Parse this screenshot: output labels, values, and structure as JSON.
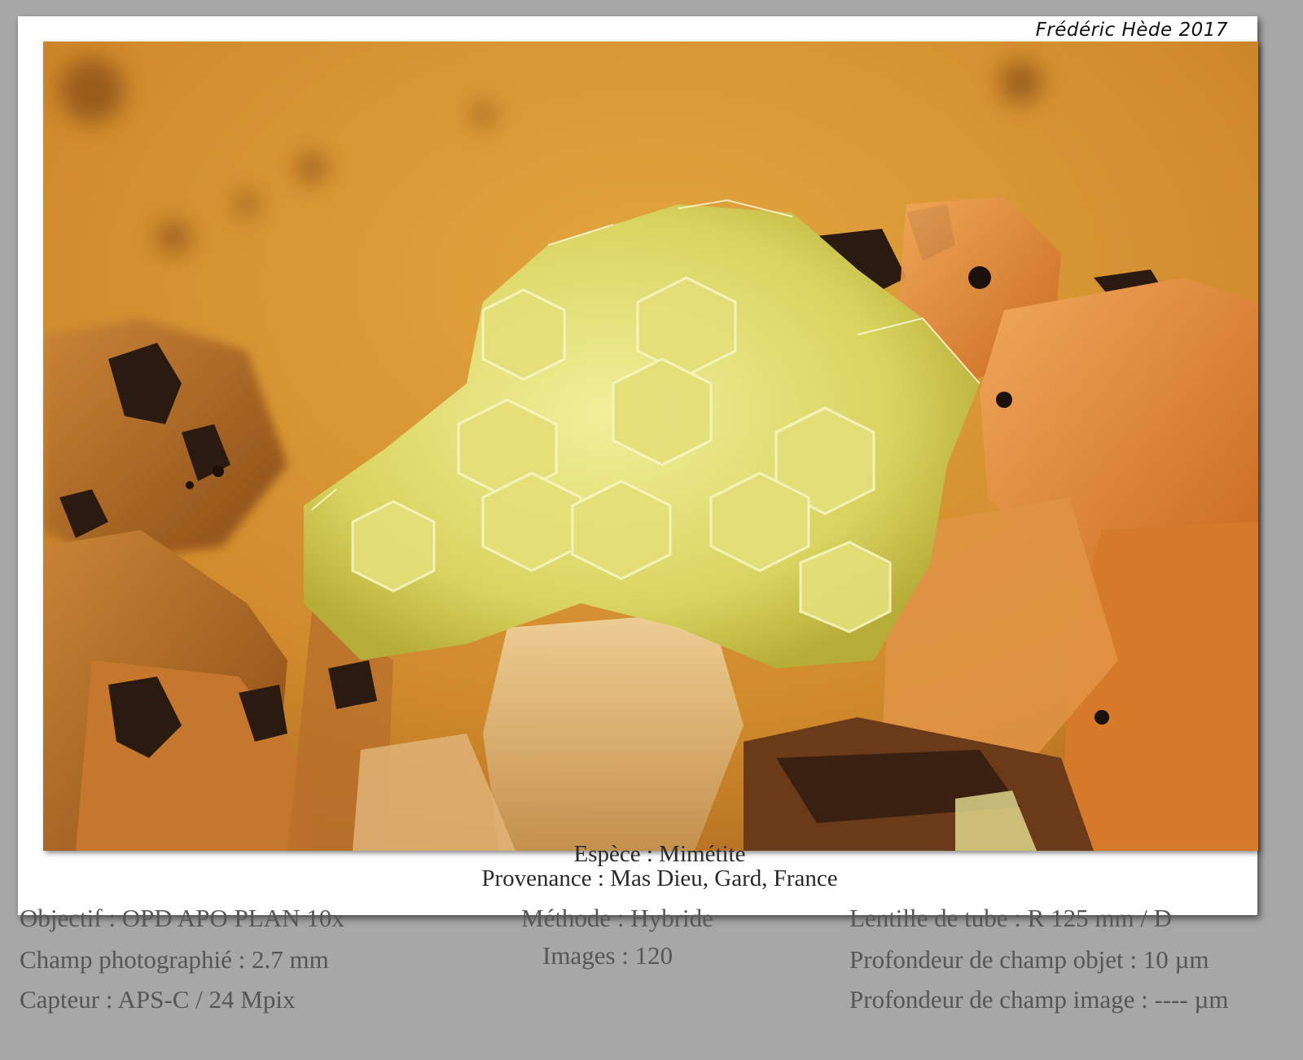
{
  "signature": "Frédéric Hède 2017",
  "photo": {
    "subject": "mineral-specimen-photo"
  },
  "caption": {
    "species": "Espèce : Mimétite",
    "origin": "Provenance : Mas Dieu, Gard, France"
  },
  "specs": {
    "left": [
      "Objectif : OPD APO PLAN 10x",
      "Champ photographié : 2.7 mm",
      "Capteur : APS-C / 24 Mpix"
    ],
    "middle": [
      "Méthode : Hybride",
      "Images : 120"
    ],
    "right": [
      "Lentille de tube : R 125 mm / D",
      "Profondeur de champ objet : 10 µm",
      "Profondeur de champ image : ---- µm"
    ]
  },
  "colors": {
    "background": "#a7a7a7",
    "card": "#ffffff",
    "crystal": "#e8e37a",
    "matrix": "#d98d2c"
  }
}
